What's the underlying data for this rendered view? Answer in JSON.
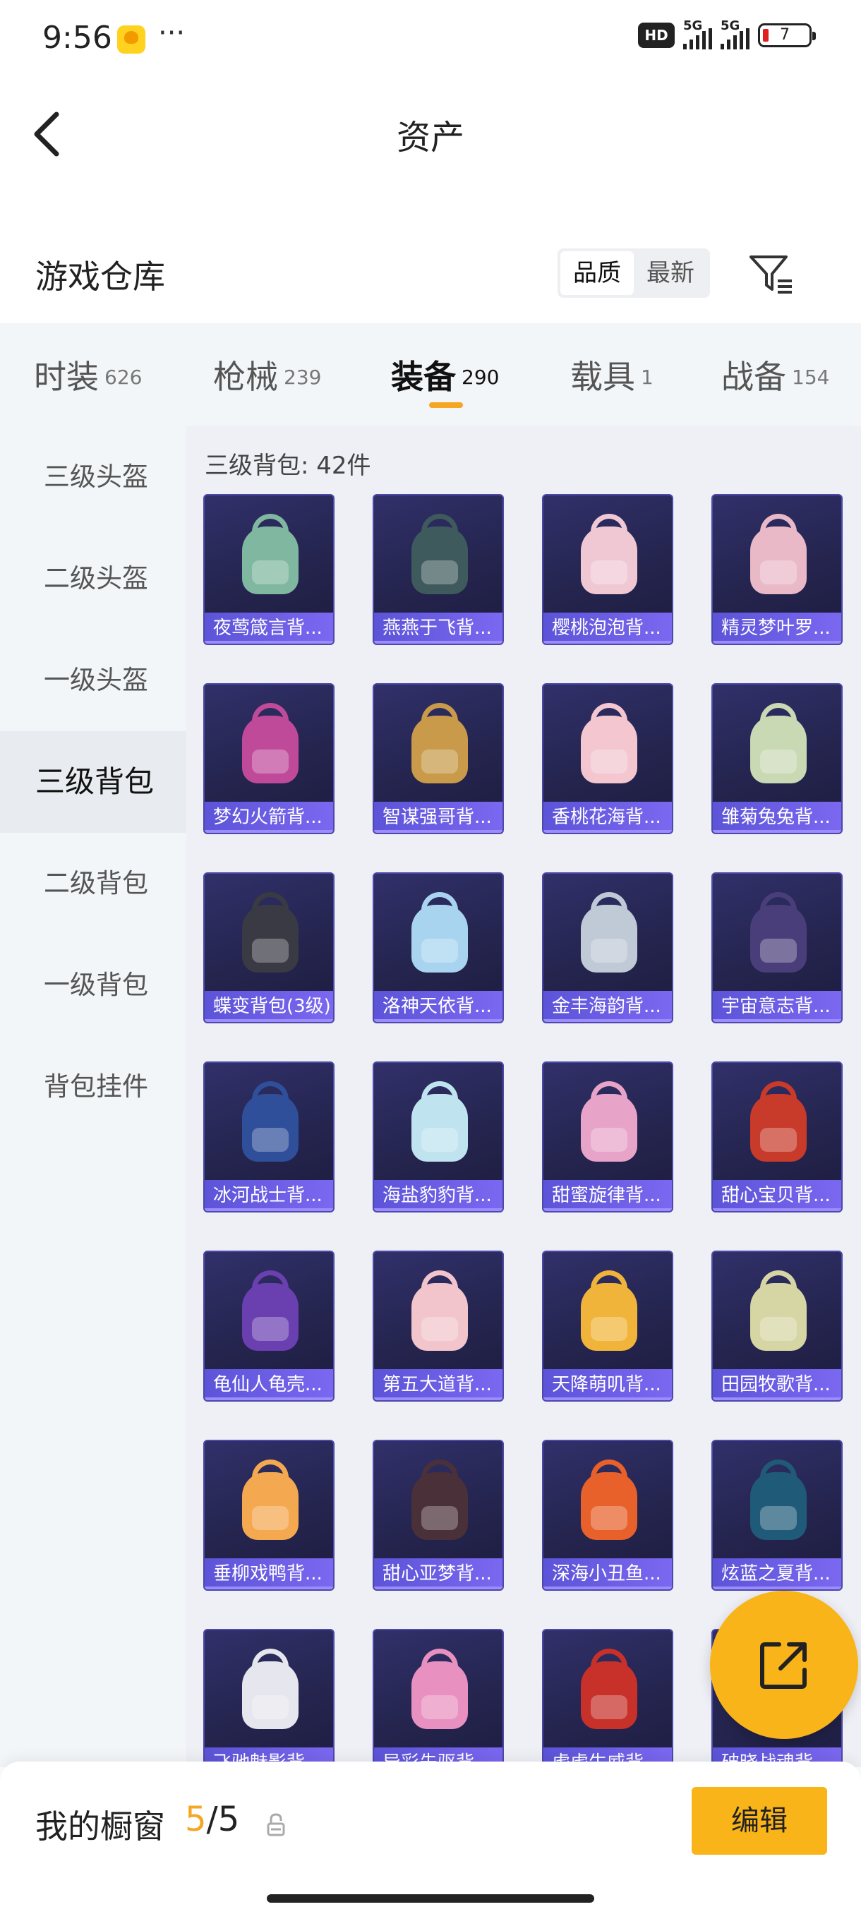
{
  "status_bar": {
    "time": "9:56",
    "overflow": "···",
    "hd": "HD",
    "net1": "5G",
    "net2": "5G",
    "battery": "7"
  },
  "nav": {
    "title": "资产"
  },
  "header": {
    "section_title": "游戏仓库",
    "sort_options": [
      "品质",
      "最新"
    ],
    "sort_selected": "品质"
  },
  "tabs": [
    {
      "label": "时装",
      "count": "626"
    },
    {
      "label": "枪械",
      "count": "239"
    },
    {
      "label": "装备",
      "count": "290"
    },
    {
      "label": "载具",
      "count": "1"
    },
    {
      "label": "战备",
      "count": "154"
    }
  ],
  "active_tab": "装备",
  "sidebar": {
    "items": [
      "三级头盔",
      "二级头盔",
      "一级头盔",
      "三级背包",
      "二级背包",
      "一级背包",
      "背包挂件"
    ],
    "active": "三级背包"
  },
  "content": {
    "heading": "三级背包: 42件",
    "items": [
      {
        "name": "夜莺箴言背...",
        "color": "#7fb7a0"
      },
      {
        "name": "燕燕于飞背...",
        "color": "#3f5a5c"
      },
      {
        "name": "樱桃泡泡背...",
        "color": "#f0c8d4"
      },
      {
        "name": "精灵梦叶罗...",
        "color": "#e9b9c8"
      },
      {
        "name": "梦幻火箭背...",
        "color": "#c04a9a"
      },
      {
        "name": "智谋强哥背...",
        "color": "#c89a4a"
      },
      {
        "name": "香桃花海背...",
        "color": "#f3c6d0"
      },
      {
        "name": "雏菊兔兔背...",
        "color": "#c9d9b4"
      },
      {
        "name": "蝶变背包(3级)",
        "color": "#3a3a44"
      },
      {
        "name": "洛神天依背...",
        "color": "#a8d4f0"
      },
      {
        "name": "金丰海韵背...",
        "color": "#bfcad6"
      },
      {
        "name": "宇宙意志背...",
        "color": "#4a3e7a"
      },
      {
        "name": "冰河战士背...",
        "color": "#2f4f9a"
      },
      {
        "name": "海盐豹豹背...",
        "color": "#bfe4f0"
      },
      {
        "name": "甜蜜旋律背...",
        "color": "#e8a4c8"
      },
      {
        "name": "甜心宝贝背...",
        "color": "#c83a2a"
      },
      {
        "name": "龟仙人龟壳...",
        "color": "#6a3fb0"
      },
      {
        "name": "第五大道背...",
        "color": "#f2c4cc"
      },
      {
        "name": "天降萌叽背...",
        "color": "#f0b43a"
      },
      {
        "name": "田园牧歌背...",
        "color": "#d6d6a4"
      },
      {
        "name": "垂柳戏鸭背...",
        "color": "#f4a850"
      },
      {
        "name": "甜心亚梦背...",
        "color": "#4a3038"
      },
      {
        "name": "深海小丑鱼...",
        "color": "#e8602a"
      },
      {
        "name": "炫蓝之夏背...",
        "color": "#1f5a78"
      },
      {
        "name": "飞驰魅影背...",
        "color": "#e6e6ee"
      },
      {
        "name": "异彩先驱背...",
        "color": "#e890c0"
      },
      {
        "name": "虎虎生威背...",
        "color": "#c8302a"
      },
      {
        "name": "破晓战魂背...",
        "color": "#3a3a3a"
      }
    ]
  },
  "bottom": {
    "showcase_label": "我的橱窗",
    "used": "5",
    "separator": "/",
    "total": "5",
    "edit_label": "编辑"
  },
  "colors": {
    "accent": "#f9b41a",
    "card_label": "#6a5ee8"
  }
}
